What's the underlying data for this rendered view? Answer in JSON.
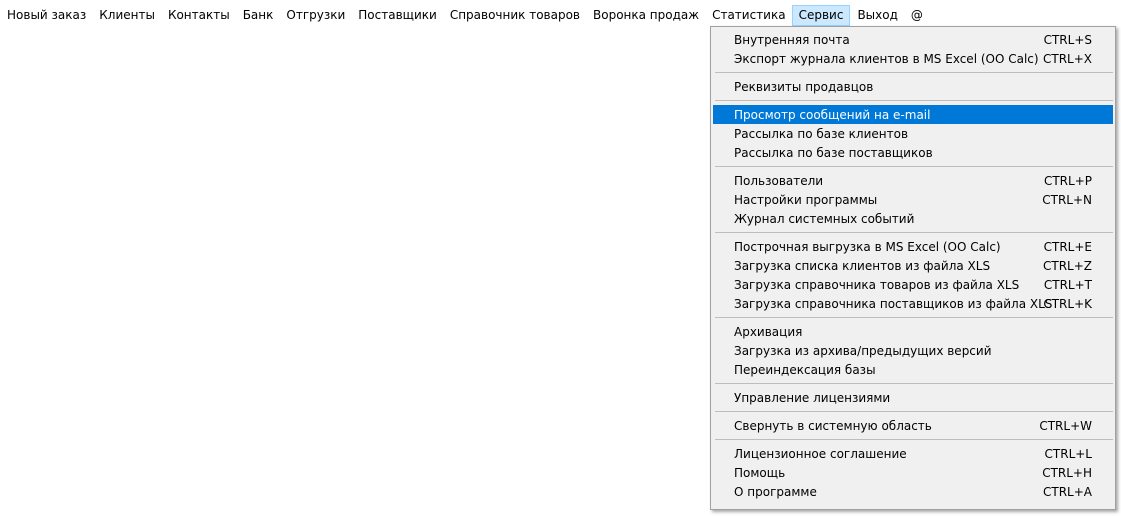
{
  "menubar": {
    "items": [
      {
        "label": "Новый заказ"
      },
      {
        "label": "Клиенты"
      },
      {
        "label": "Контакты"
      },
      {
        "label": "Банк"
      },
      {
        "label": "Отгрузки"
      },
      {
        "label": "Поставщики"
      },
      {
        "label": "Справочник товаров"
      },
      {
        "label": "Воронка продаж"
      },
      {
        "label": "Статистика"
      },
      {
        "label": "Сервис"
      },
      {
        "label": "Выход"
      },
      {
        "label": "@"
      }
    ]
  },
  "service_menu": {
    "items": [
      {
        "label": "Внутренняя почта",
        "shortcut": "CTRL+S"
      },
      {
        "label": "Экспорт журнала клиентов в MS Excel (OO Calc)",
        "shortcut": "CTRL+X"
      },
      {
        "label": "Реквизиты продавцов",
        "shortcut": ""
      },
      {
        "label": "Просмотр сообщений на e-mail",
        "shortcut": ""
      },
      {
        "label": "Рассылка по базе клиентов",
        "shortcut": ""
      },
      {
        "label": "Рассылка по базе поставщиков",
        "shortcut": ""
      },
      {
        "label": "Пользователи",
        "shortcut": "CTRL+P"
      },
      {
        "label": "Настройки программы",
        "shortcut": "CTRL+N"
      },
      {
        "label": "Журнал системных событий",
        "shortcut": ""
      },
      {
        "label": "Построчная выгрузка в MS Excel (OO Calc)",
        "shortcut": "CTRL+E"
      },
      {
        "label": "Загрузка списка клиентов из файла XLS",
        "shortcut": "CTRL+Z"
      },
      {
        "label": "Загрузка справочника товаров из файла XLS",
        "shortcut": "CTRL+T"
      },
      {
        "label": "Загрузка справочника поставщиков из файла XLS",
        "shortcut": "CTRL+K"
      },
      {
        "label": "Архивация",
        "shortcut": ""
      },
      {
        "label": "Загрузка из архива/предыдущих версий",
        "shortcut": ""
      },
      {
        "label": "Переиндексация базы",
        "shortcut": ""
      },
      {
        "label": "Управление лицензиями",
        "shortcut": ""
      },
      {
        "label": "Свернуть в системную область",
        "shortcut": "CTRL+W"
      },
      {
        "label": "Лицензионное соглашение",
        "shortcut": "CTRL+L"
      },
      {
        "label": "Помощь",
        "shortcut": "CTRL+H"
      },
      {
        "label": "О программе",
        "shortcut": "CTRL+A"
      }
    ]
  },
  "colors": {
    "highlight": "#0078d7",
    "open_menu_bg": "#cce8ff",
    "menu_bg": "#f0f0f0"
  }
}
